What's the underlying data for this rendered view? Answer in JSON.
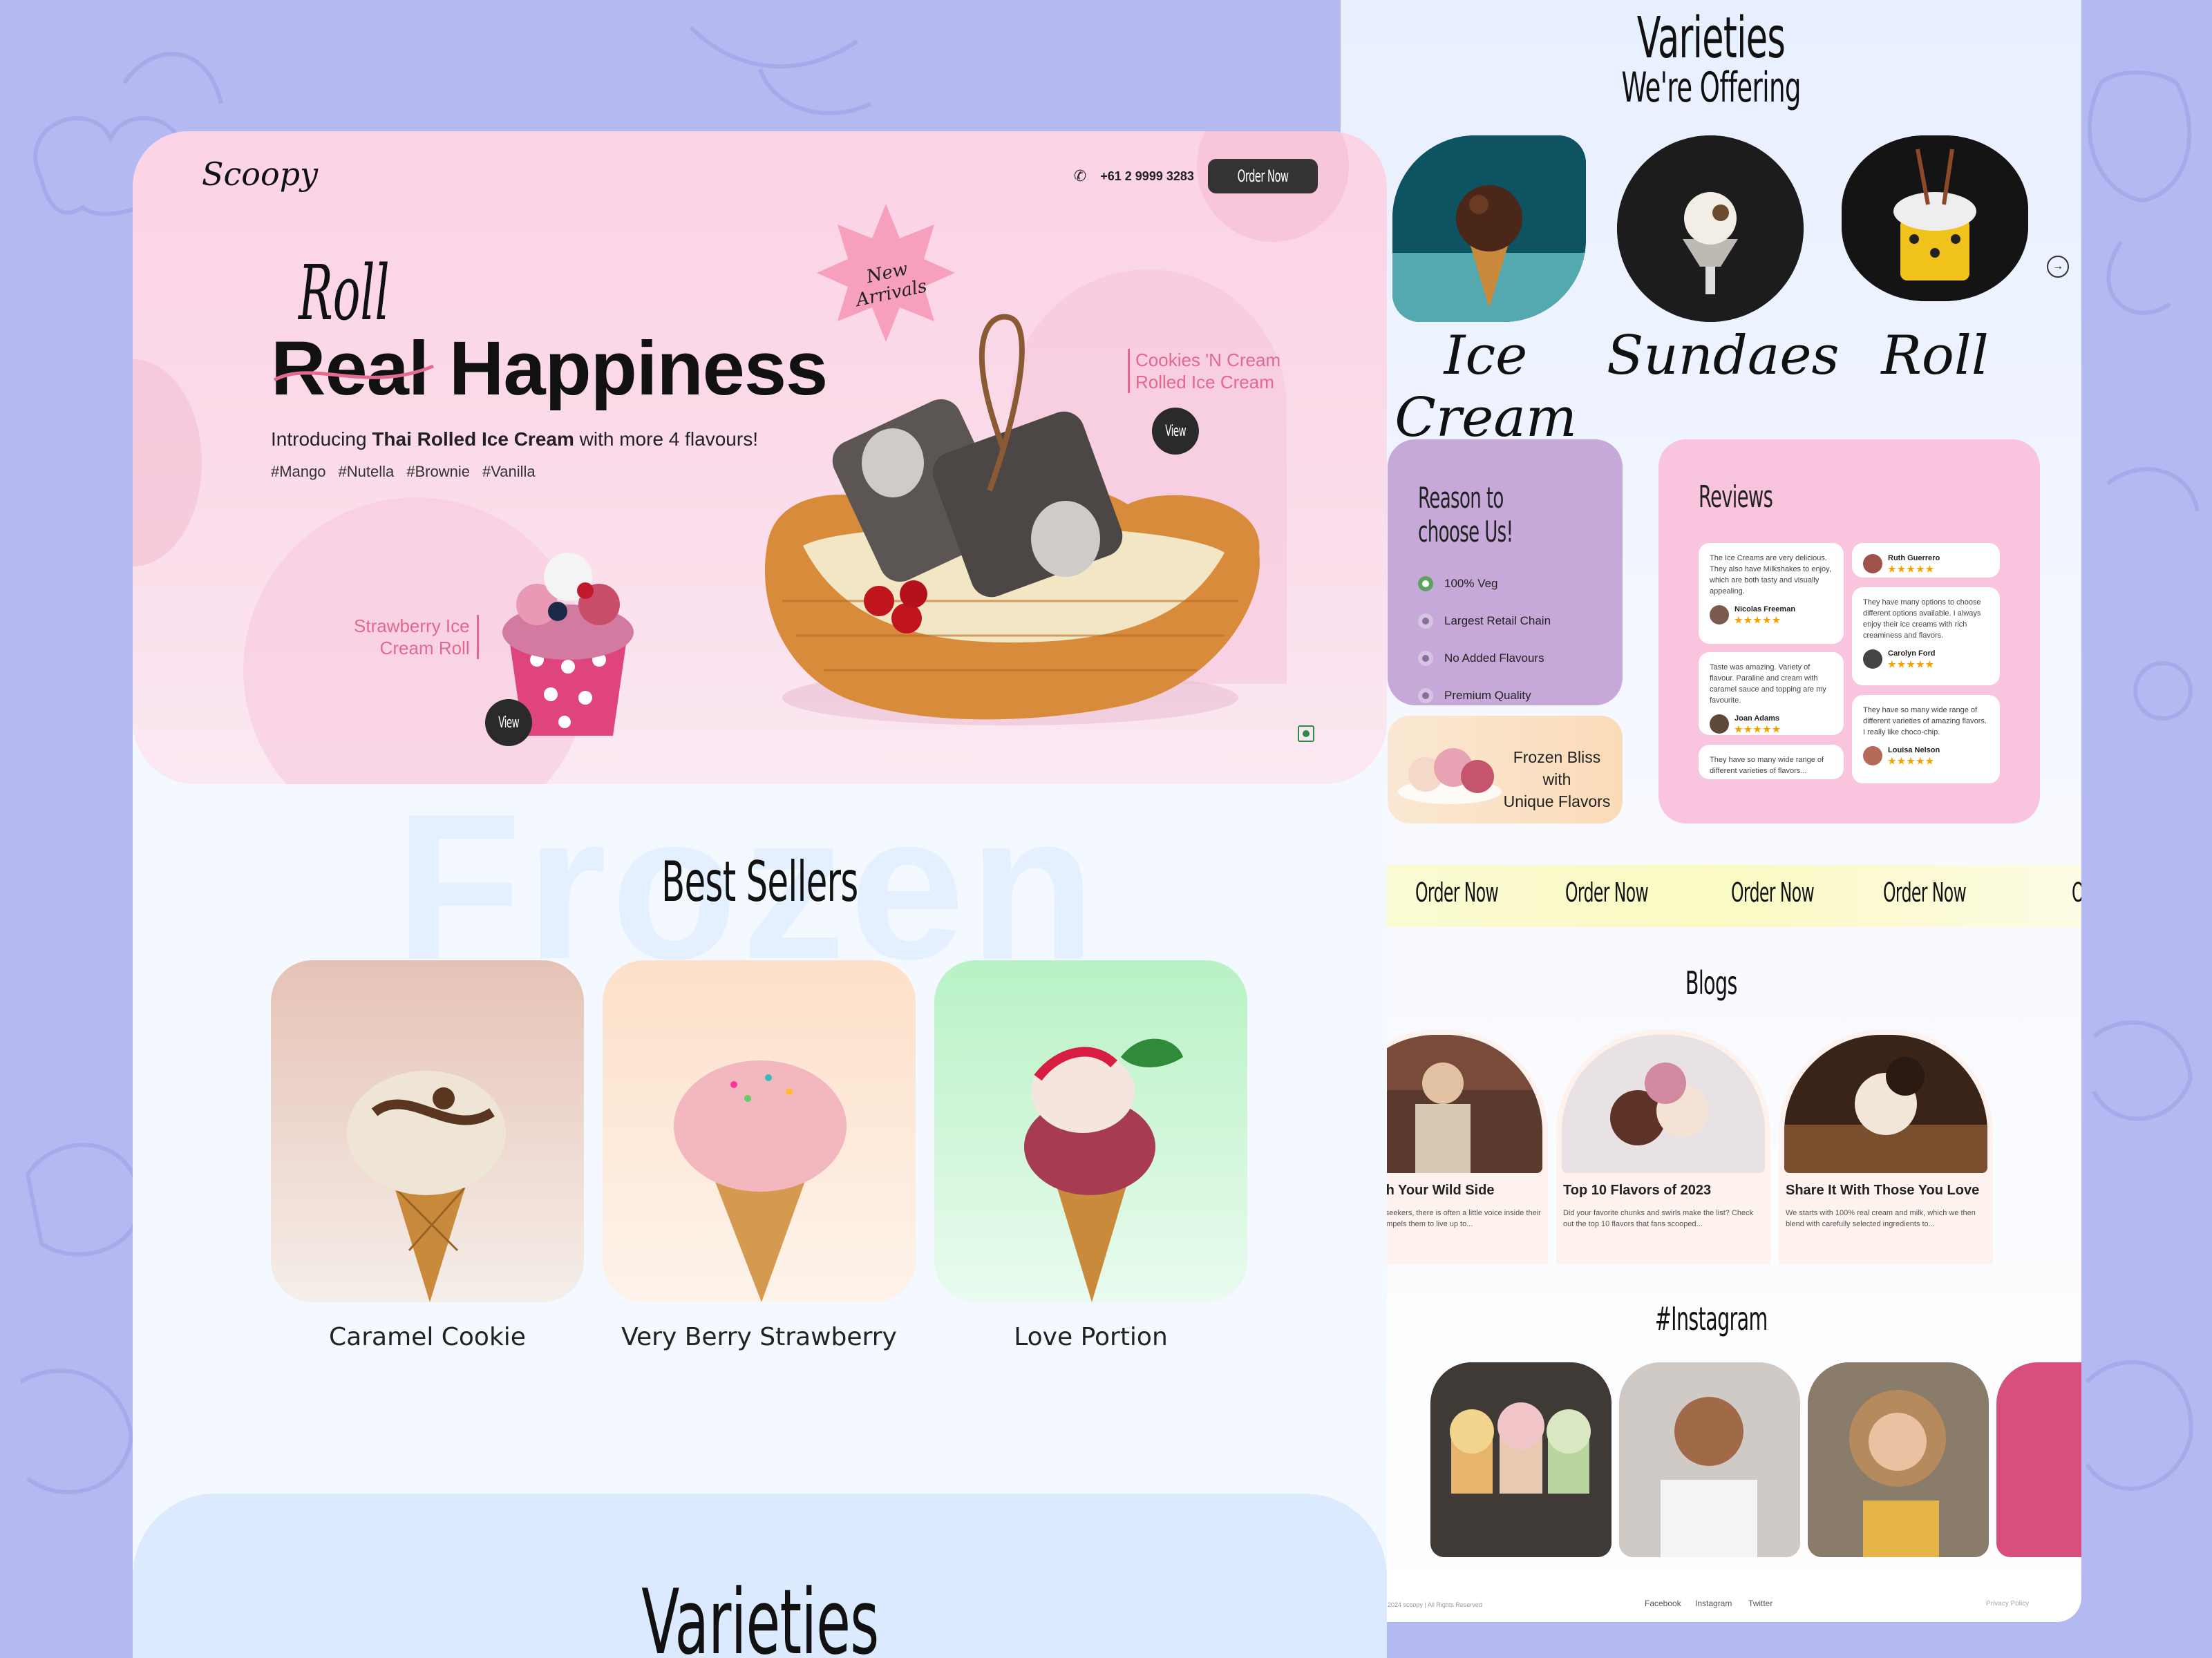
{
  "colors": {
    "page_background": "#b4b9f2",
    "hero_pink": "#fbd3e6",
    "accent_pink": "#e3688f",
    "reason_card": "#c7a9d9",
    "reviews_card": "#f9c5de",
    "dark_button": "#333333",
    "star": "#f2a300",
    "order_strip": "#fafac2"
  },
  "hero": {
    "logo": "Scoopy",
    "phone": "+61 2 9999 3283",
    "order_button": "Order Now",
    "badge": "New Arrivals",
    "script_word": "Roll",
    "headline": "Real Happiness",
    "subtitle_prefix": "Introducing ",
    "subtitle_bold": "Thai Rolled Ice Cream",
    "subtitle_suffix": " with more 4 flavours!",
    "tags": [
      "#Mango",
      "#Nutella",
      "#Brownie",
      "#Vanilla"
    ],
    "label_right": [
      "Cookies 'N Cream",
      "Rolled Ice Cream"
    ],
    "label_left": [
      "Strawberry Ice",
      "Cream Roll"
    ],
    "view_label": "View",
    "watermark": "Frozen"
  },
  "best_sellers": {
    "title": "Best Sellers",
    "items": [
      {
        "name": "Caramel Cookie"
      },
      {
        "name": "Very Berry Strawberry"
      },
      {
        "name": "Love Portion"
      }
    ]
  },
  "varieties_bottom_title": "Varieties",
  "right": {
    "varieties_title_1": "Varieties",
    "varieties_title_2": "We're Offering",
    "varieties": [
      "Ice Cream",
      "Sundaes",
      "Roll"
    ],
    "reason": {
      "title": "Reason to choose Us!",
      "items": [
        "100% Veg",
        "Largest Retail Chain",
        "No Added Flavours",
        "Premium Quality"
      ]
    },
    "frozen_bliss": [
      "Frozen Bliss with",
      "Unique Flavors"
    ],
    "reviews": {
      "title": "Reviews",
      "items": [
        {
          "text": "The Ice Creams are very delicious. They also have Milkshakes to enjoy, which are both tasty and visually appealing.",
          "name": "Nicolas Freeman"
        },
        {
          "text": "",
          "name": "Ruth Guerrero"
        },
        {
          "text": "They have many options to choose different options available. I always enjoy their ice creams with rich creaminess and flavors.",
          "name": "Carolyn Ford"
        },
        {
          "text": "Taste was amazing. Variety of flavour. Paraline and cream with caramel sauce and topping are my favourite.",
          "name": "Joan Adams"
        },
        {
          "text": "They have so many wide range of different varieties of amazing flavors. I really like choco-chip.",
          "name": "Louisa Nelson"
        },
        {
          "text": "They have so many wide range of different varieties of flavors...",
          "name": ""
        }
      ],
      "stars": "★★★★★"
    },
    "order_strip": [
      "Order Now",
      "Order Now",
      "Order Now",
      "Order Now",
      "O"
    ],
    "blogs": {
      "title": "Blogs",
      "items": [
        {
          "title": "Unleash Your Wild Side",
          "text": "For pleasure seekers, there is often a little voice inside their heads that compels them to live up to..."
        },
        {
          "title": "Top 10 Flavors of 2023",
          "text": "Did your favorite chunks and swirls make the list? Check out the top 10 flavors that fans scooped..."
        },
        {
          "title": "Share It With Those You Love",
          "text": "We starts with 100% real cream and milk, which we then blend with carefully selected ingredients to..."
        }
      ]
    },
    "instagram_title": "#Instagram",
    "footer": {
      "copyright": "2024 scoopy | All Rights Reserved",
      "links": [
        "Facebook",
        "Instagram",
        "Twitter"
      ],
      "privacy": "Privacy Policy"
    }
  }
}
